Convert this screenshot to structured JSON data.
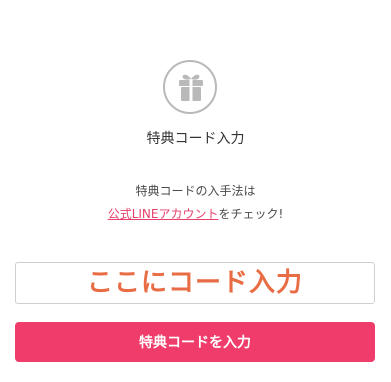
{
  "header": {
    "icon": "gift-icon",
    "title": "特典コード入力"
  },
  "instructions": {
    "line1": "特典コードの入手法は",
    "link_text": "公式LINEアカウント",
    "line2_suffix": "をチェック!"
  },
  "code_input": {
    "value": "",
    "placeholder": "ここにコード入力"
  },
  "submit": {
    "label": "特典コードを入力"
  },
  "colors": {
    "accent": "#ef3c6a",
    "placeholder": "#e86c44",
    "link": "#e6406b"
  }
}
